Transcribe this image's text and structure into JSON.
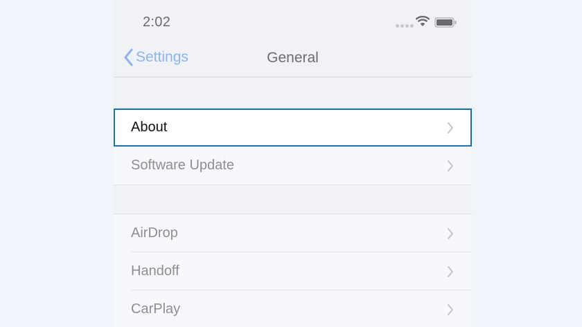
{
  "status_bar": {
    "time": "2:02"
  },
  "nav": {
    "back_label": "Settings",
    "title": "General"
  },
  "groups": [
    {
      "items": [
        {
          "label": "About",
          "selected": true
        },
        {
          "label": "Software Update",
          "selected": false
        }
      ]
    },
    {
      "items": [
        {
          "label": "AirDrop",
          "selected": false
        },
        {
          "label": "Handoff",
          "selected": false
        },
        {
          "label": "CarPlay",
          "selected": false
        }
      ]
    }
  ],
  "colors": {
    "accent": "#8ab3f0",
    "selection_outline": "#1a73a8"
  },
  "icons": {
    "back": "chevron-left-icon",
    "disclosure": "chevron-right-icon",
    "wifi": "wifi-icon",
    "battery": "battery-icon",
    "signal": "signal-dots-icon"
  }
}
